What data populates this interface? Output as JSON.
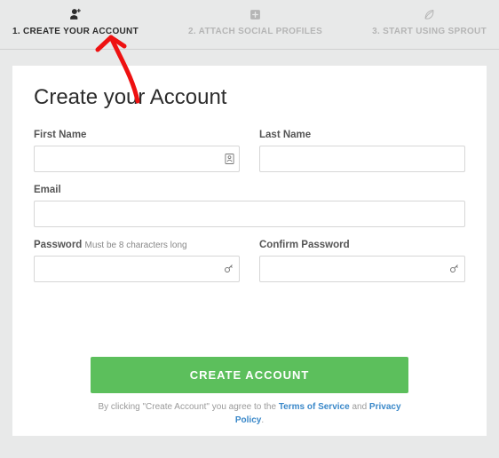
{
  "steps": {
    "step1": {
      "label": "1. CREATE YOUR ACCOUNT"
    },
    "step2": {
      "label": "2. ATTACH SOCIAL PROFILES"
    },
    "step3": {
      "label": "3. START USING SPROUT"
    }
  },
  "form": {
    "title": "Create your Account",
    "first_name_label": "First Name",
    "first_name_value": "",
    "last_name_label": "Last Name",
    "last_name_value": "",
    "email_label": "Email",
    "email_value": "",
    "password_label": "Password",
    "password_hint": "Must be 8 characters long",
    "password_value": "",
    "confirm_password_label": "Confirm Password",
    "confirm_password_value": ""
  },
  "cta": {
    "button_label": "CREATE ACCOUNT",
    "agreement_prefix": "By clicking \"Create Account\" you agree to the ",
    "tos_label": "Terms of Service",
    "and": " and ",
    "privacy_label": "Privacy Policy",
    "suffix": "."
  }
}
